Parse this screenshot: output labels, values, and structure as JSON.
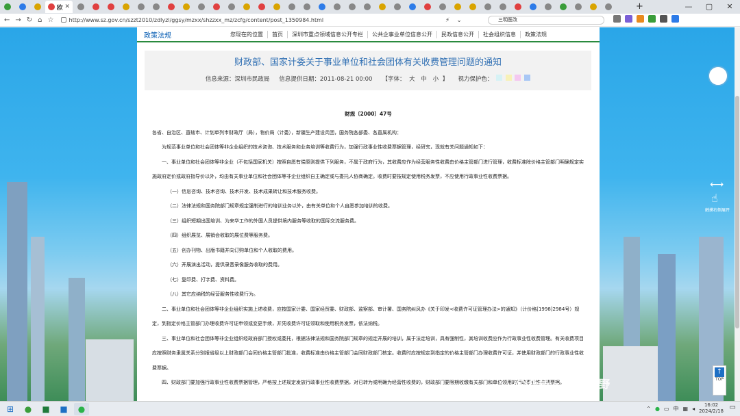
{
  "browser": {
    "active_tab_label": "欧",
    "tab_icon_colors": [
      "#3a9d3a",
      "#2d7be8",
      "#d9a400",
      "#e04040",
      "#888",
      "#e04040",
      "#e04040",
      "#d9a400",
      "#888",
      "#888",
      "#e04040",
      "#d9a400",
      "#888",
      "#e04040",
      "#888",
      "#d9a400",
      "#e04040",
      "#d9a400",
      "#888",
      "#888",
      "#2d7be8",
      "#888",
      "#888",
      "#888",
      "#d9a400",
      "#888",
      "#2d7be8",
      "#e04040",
      "#888",
      "#d9a400",
      "#d9a400",
      "#888",
      "#888",
      "#e04040",
      "#2d7be8",
      "#888",
      "#3a9d3a",
      "#888",
      "#d9a400",
      "#888"
    ],
    "url": "http://www.sz.gov.cn/szzt2010/zdlyzl/ggsy/mzxx/shzzxx_mz/zcfg/content/post_1350984.html",
    "search_text": "三明医改",
    "window_controls": [
      "—",
      "▢",
      "✕"
    ],
    "new_tab": "+"
  },
  "site": {
    "section_title": "政策法规",
    "breadcrumb": [
      "您现在的位置",
      "首页",
      "深圳市重点领域信息公开专栏",
      "公共企事业单位信息公开",
      "民政信息公开",
      "社会组织信息",
      "政策法规"
    ]
  },
  "article": {
    "title": "财政部、国家计委关于事业单位和社会团体有关收费管理问题的通知",
    "source": "信息来源：深圳市民政局",
    "date": "信息提供日期：2011-08-21 00:00",
    "font_size_label": "【字体：",
    "font_sizes": [
      "大",
      "中",
      "小"
    ],
    "font_size_end": "】",
    "eye_label": "视力保护色：",
    "eye_colors": [
      "#d6f2f5",
      "#f7f1b8",
      "#f4c8f0",
      "#a8c7f5"
    ],
    "doc_no": "财规〔2000〕47号",
    "addressees": "各省、自治区、直辖市、计划单列市财政厅（局），物价局（计委），新疆生产建设兵团，国务院各部委、各直属机构：",
    "intro": "为规范事业单位和社会团体等非企业组织的技术咨询、技术服务和业务培训等收费行为，加强行政事业性收费票据管理，经研究，现就有关问题通知如下：",
    "para1": "一、事业单位和社会团体等非企业（不包括国家机关）按照自愿有偿原则提供下列服务，不属于政府行为，其收费应作为经营服务性收费由价格主管部门进行管理，收费标准除价格主管部门明确规定实施政府定价或政府指导价以外，均由有关事业单位和社会团体等非企业组织自主确定或与委托人协商确定。收费时要按规定使用税务发票，不应使用行政事业性收费票据。",
    "items": [
      "（一）信息咨询、技术咨询、技术开发、技术成果转让和技术服务收费。",
      "（二）法律法规和国务院部门规章规定强制进行的培训业务以外，由有关单位和个人自愿参加培训的收费。",
      "（三）组织短期出国培训、为来华工作的外国人员提供境内服务等收取的国际交流服务费。",
      "（四）组织展览、展销会收取的展位费等服务费。",
      "（五）创办刊物、出版书籍并向订购单位和个人收取的费用。",
      "（六）开展演出活动，提供录音录像服务收取的费用。",
      "（七）复印费、打字费、资料费。",
      "（八）其它应纳税的经营服务性收费行为。"
    ],
    "para2": "二、事业单位和社会团体等非企业组织实施上述收费，应按国家计委、国家经贸委、财政部、监察部、审计署、国务院纠风办《关于印发<收费许可证管理办法>的通知》（计价格[1998]2984号）规定，到指定价格主管部门办理收费许可证申领或变更手续，并凭收费许可证领取和使用税务发票，依法纳税。",
    "para3": "三、事业单位和社会团体等非企业组织经政府部门授权或委托，根据法律法规和国务院部门规章的规定开展的培训，属于法定培训，具有强制性，其培训收费应作为行政事业性收费管理。有关收费项目应按照财务隶属关系分别报省级以上财政部门会同价格主管部门批准，收费标准由价格主管部门会同财政部门核定。收费时应按规定到指定的价格主管部门办理收费许可证，并使用财政部门的行政事业性收费票据。",
    "para4": "四、财政部门要加强行政事业性收费票据管理，严格按上述规定发放行政事业性收费票据，对已转为或明确为经营性收费的，财政部门要限期收缴有关部门和单位领用的行政事业性收费票据。"
  },
  "side": {
    "drag_text": "触摸右侧展开",
    "top_label": "TOP"
  },
  "watermark": "公众号 · 财会视野",
  "taskbar": {
    "time": "16:02",
    "date": "2024/2/18",
    "lang": "中"
  }
}
